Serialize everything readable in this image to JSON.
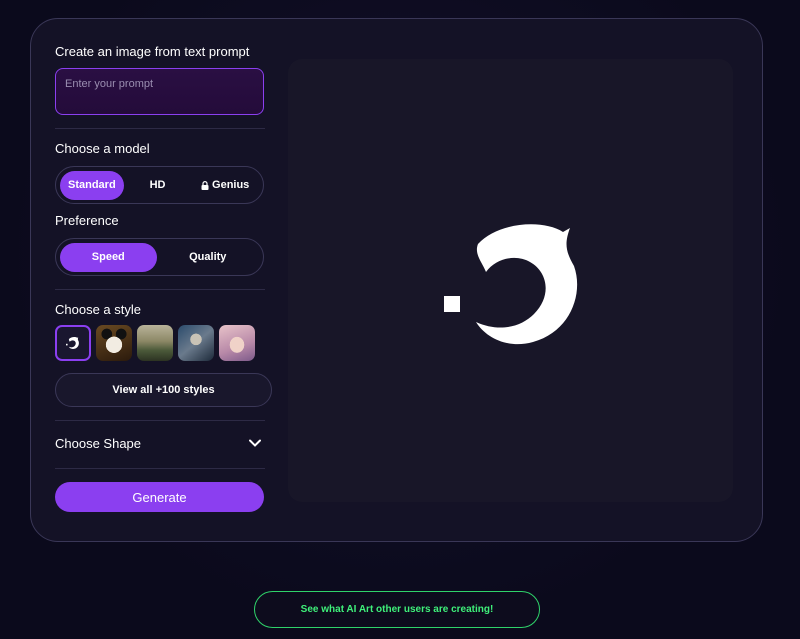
{
  "panel": {
    "prompt_title": "Create an image from text prompt",
    "prompt_placeholder": "Enter your prompt",
    "model_title": "Choose a model",
    "models": [
      {
        "label": "Standard",
        "active": true
      },
      {
        "label": "HD",
        "active": false
      },
      {
        "label": "Genius",
        "active": false,
        "locked": true
      }
    ],
    "preference_title": "Preference",
    "preferences": [
      {
        "label": "Speed",
        "active": true
      },
      {
        "label": "Quality",
        "active": false
      }
    ],
    "style_title": "Choose a style",
    "styles": [
      "logo-style",
      "panda-style",
      "landscape-style",
      "robot-style",
      "portrait-style"
    ],
    "view_all_label": "View all +100 styles",
    "shape_title": "Choose Shape",
    "generate_label": "Generate"
  },
  "cta_label": "See what AI Art other users are creating!",
  "colors": {
    "accent": "#8b3ff0",
    "background": "#0b0a1c",
    "card": "#141226",
    "cta_green": "#3ff07a"
  },
  "icons": [
    "lock-icon",
    "chevron-down-icon",
    "dolphin-logo-icon"
  ]
}
